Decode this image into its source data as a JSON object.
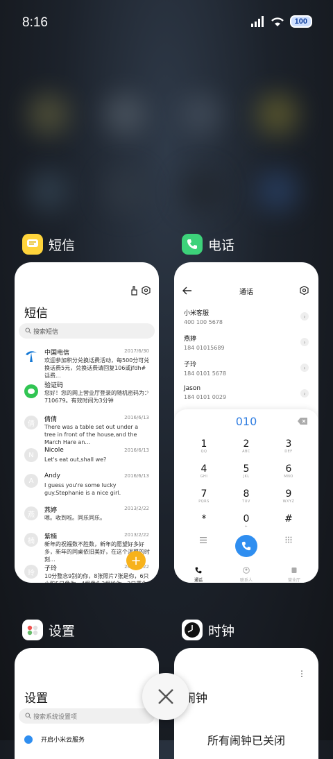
{
  "status": {
    "time": "8:16",
    "battery": "100"
  },
  "apps": {
    "messages": {
      "label": "短信",
      "card": {
        "title": "短信",
        "search_placeholder": "搜索短信",
        "items": [
          {
            "name": "中国电信",
            "date": "2017/6/30",
            "text": "欢迎参加积分兑换话费活动，每500分可兑换话费5元，兑换话费请回复106或jfdh#话费..."
          },
          {
            "name": "验证码",
            "date": "",
            "text": "您好！您的网上营业厅登录的随机密码为：710679。有效时间为3分钟"
          },
          {
            "name": "倩倩",
            "date": "2016/6/13",
            "text": "There was a table set out under a tree in front of the house,and the March Hare an...",
            "avatar": "倩"
          },
          {
            "name": "Nicole",
            "date": "2016/6/13",
            "text": "Let's eat out,shall we?",
            "avatar": "N"
          },
          {
            "name": "Andy",
            "date": "2016/6/13",
            "text": "I guess you're some lucky guy.Stephanie is a nice girl.",
            "avatar": "A"
          },
          {
            "name": "燕婷",
            "date": "2013/2/22",
            "text": "嗯。收到啦。同乐同乐。",
            "avatar": "燕"
          },
          {
            "name": "紫楠",
            "date": "2013/2/22",
            "text": "新年的祝福数不胜数，新年的愿望好多好多，新年的同桌依旧美好，在这个温馨的时刻...",
            "avatar": "楠"
          },
          {
            "name": "子玲",
            "date": "2013/2/22",
            "text": "10分整念9别的你，8张照片7张是你，6只小狗5只像你，4根骨头3根给你，2只重你1...",
            "avatar": "玲"
          }
        ]
      }
    },
    "phone": {
      "label": "电话",
      "card": {
        "title": "通话",
        "contacts": [
          {
            "name": "小米客服",
            "number": "400 100 5678"
          },
          {
            "name": "燕婷",
            "number": "184 01015689"
          },
          {
            "name": "子玲",
            "number": "184 0101 5678"
          },
          {
            "name": "Jason",
            "number": "184 0101 0029"
          }
        ],
        "dial_input": "010",
        "keys": [
          {
            "d": "1",
            "l": "QQ"
          },
          {
            "d": "2",
            "l": "ABC"
          },
          {
            "d": "3",
            "l": "DEF"
          },
          {
            "d": "4",
            "l": "GHI"
          },
          {
            "d": "5",
            "l": "JKL"
          },
          {
            "d": "6",
            "l": "MNO"
          },
          {
            "d": "7",
            "l": "PQRS"
          },
          {
            "d": "8",
            "l": "TUV"
          },
          {
            "d": "9",
            "l": "WXYZ"
          },
          {
            "d": "*",
            "l": ""
          },
          {
            "d": "0",
            "l": "+"
          },
          {
            "d": "#",
            "l": ""
          }
        ],
        "tabs": [
          "通话",
          "联系人",
          "营业厅"
        ]
      }
    },
    "settings": {
      "label": "设置",
      "card": {
        "title": "设置",
        "search_placeholder": "搜索系统设置项",
        "first_item": "开启小米云服务"
      }
    },
    "clock": {
      "label": "时钟",
      "card": {
        "title": "闹钟",
        "status": "所有闹钟已关闭"
      }
    }
  }
}
